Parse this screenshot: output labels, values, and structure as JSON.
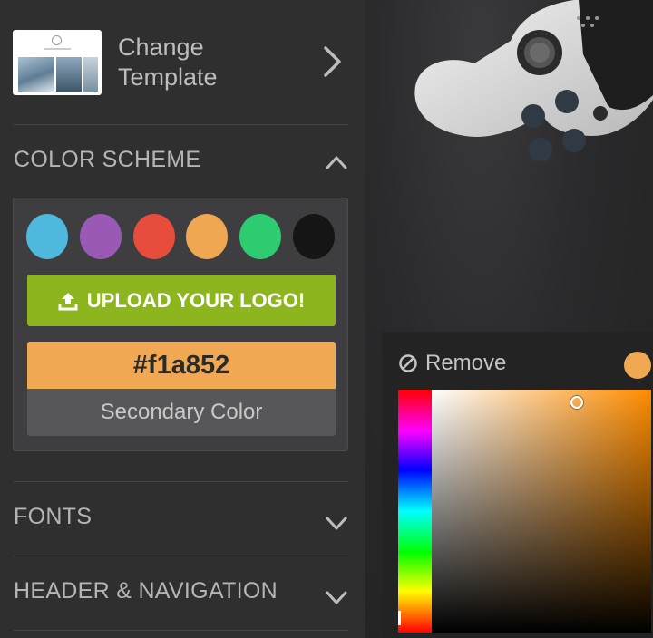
{
  "template": {
    "label_line1": "Change",
    "label_line2": "Template"
  },
  "color_scheme": {
    "title": "COLOR SCHEME",
    "swatches": [
      {
        "name": "blue",
        "color": "#4fb8dd"
      },
      {
        "name": "purple",
        "color": "#9b59b6"
      },
      {
        "name": "red",
        "color": "#e74c3c"
      },
      {
        "name": "orange",
        "color": "#f0a752"
      },
      {
        "name": "green",
        "color": "#2ecc71"
      },
      {
        "name": "black",
        "color": "#151515"
      }
    ],
    "upload_label": "UPLOAD YOUR LOGO!",
    "hex_value": "#f1a852",
    "secondary_label": "Secondary Color"
  },
  "sections": {
    "fonts": "FONTS",
    "header_nav": "HEADER & NAVIGATION"
  },
  "picker": {
    "remove_label": "Remove",
    "current_color": "#f1a852"
  },
  "colors": {
    "accent_green": "#8cb51e",
    "selected": "#f1a852",
    "sidebar_bg": "#2f2f2f"
  },
  "icons": [
    "chevron-right-icon",
    "chevron-up-icon",
    "chevron-down-icon",
    "upload-icon",
    "remove-icon"
  ]
}
